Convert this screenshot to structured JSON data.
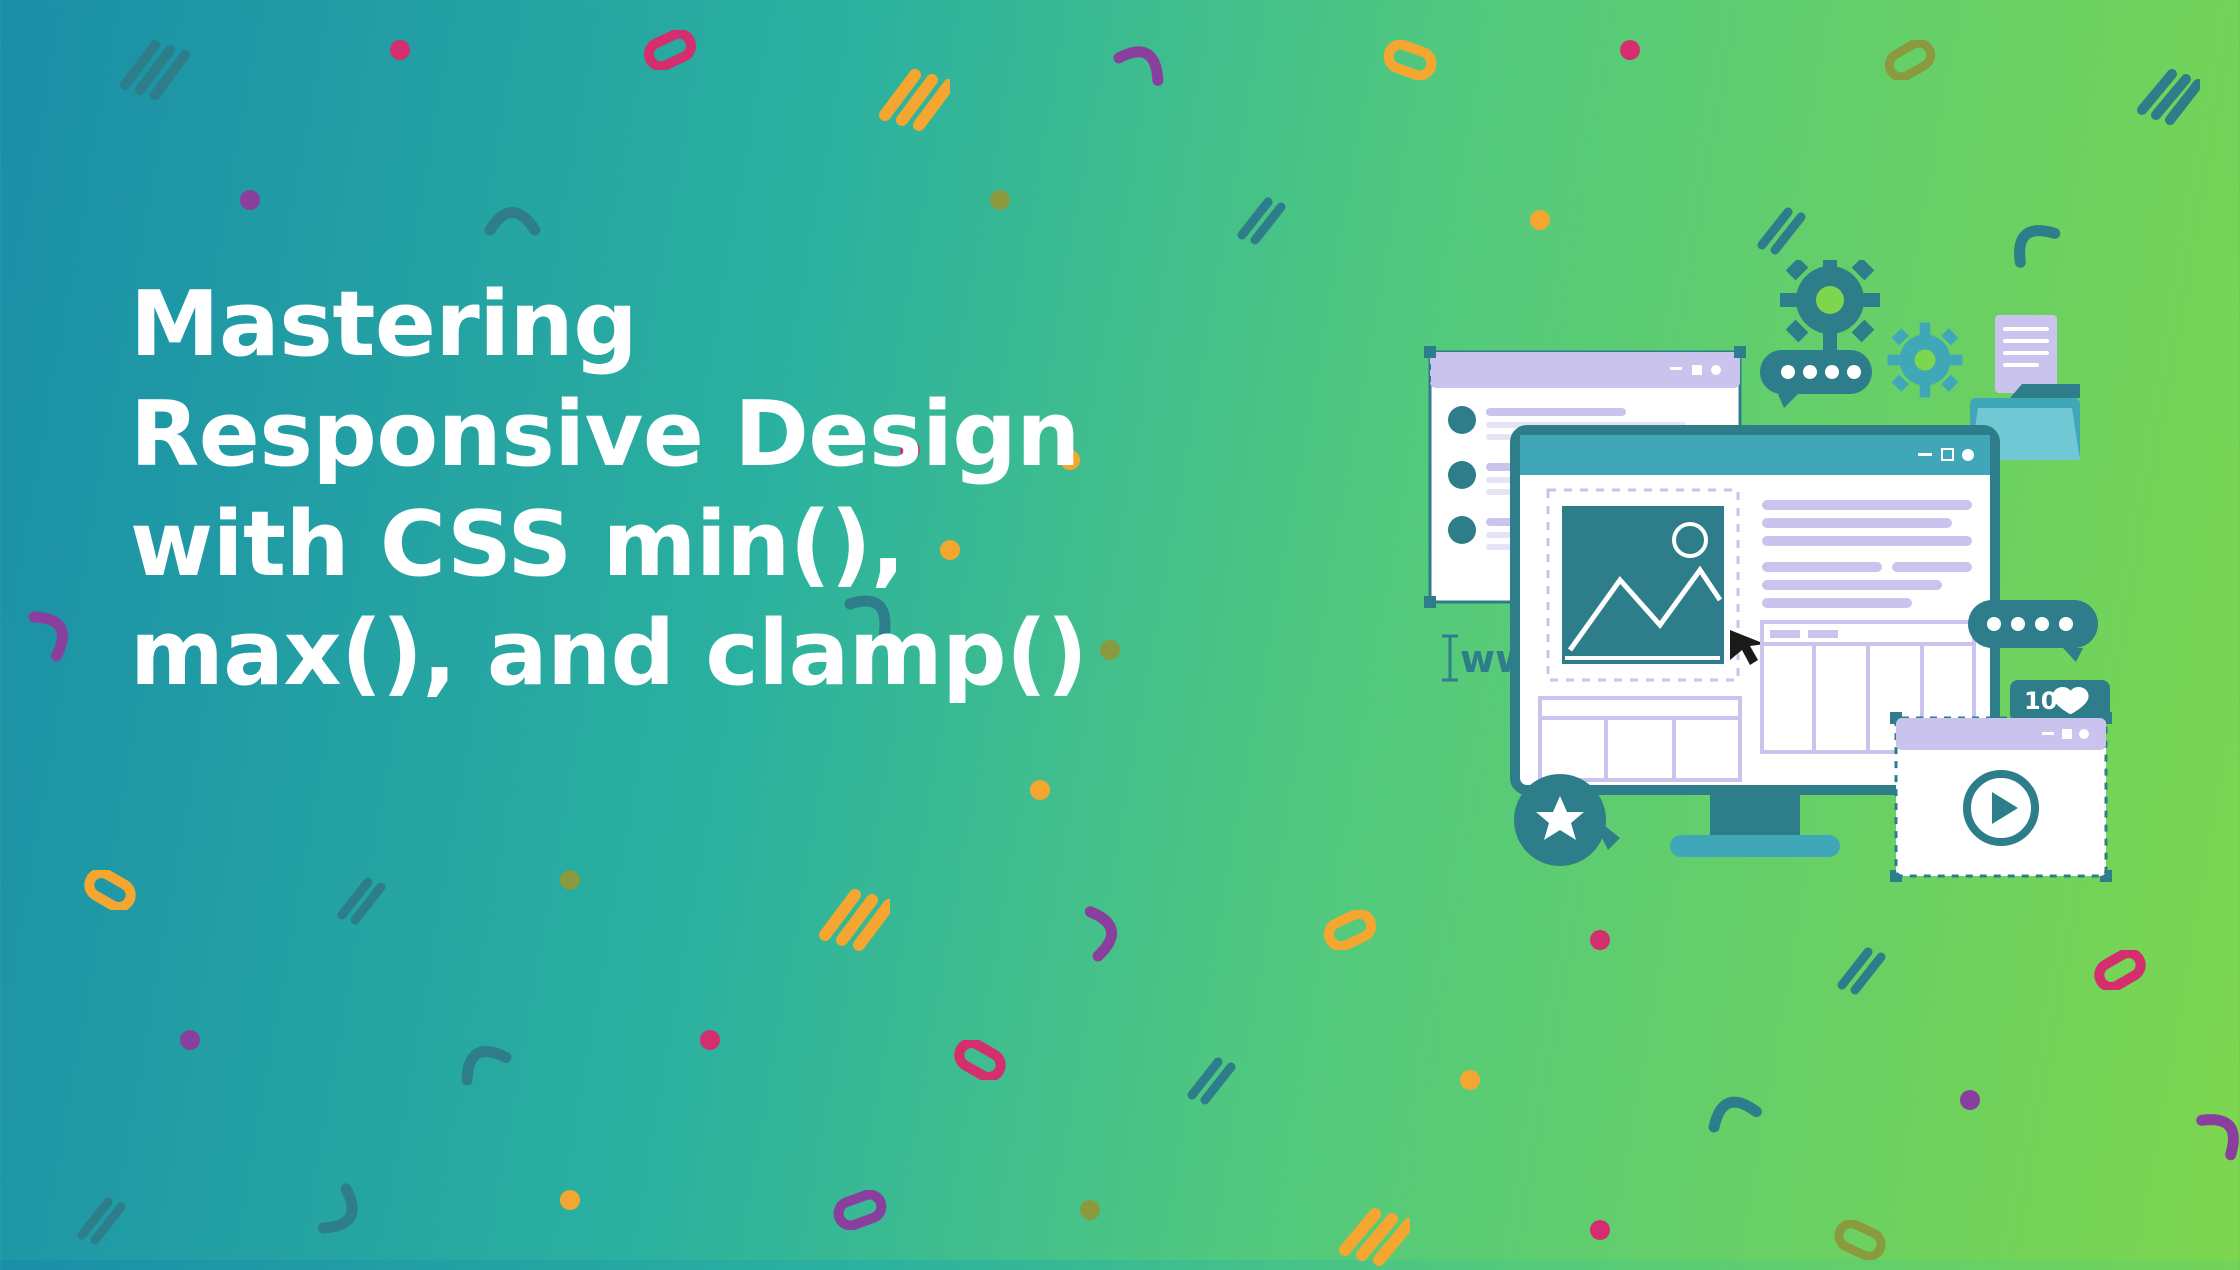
{
  "hero": {
    "title_line1": "Mastering",
    "title_line2": "Responsive Design",
    "title_line3": "with CSS min(),",
    "title_line4": "max(), and clamp()"
  },
  "illustration": {
    "www_label": "www",
    "like_count": "100"
  },
  "palette": {
    "teal": "#2e7d8a",
    "tealLight": "#3fa7b8",
    "lavender": "#c9c3ed",
    "white": "#ffffff",
    "orange": "#f4a630",
    "magenta": "#d42e6f",
    "purple": "#8a3f9e",
    "olive": "#8a9a3f",
    "darkTeal": "#1f6b7a"
  }
}
